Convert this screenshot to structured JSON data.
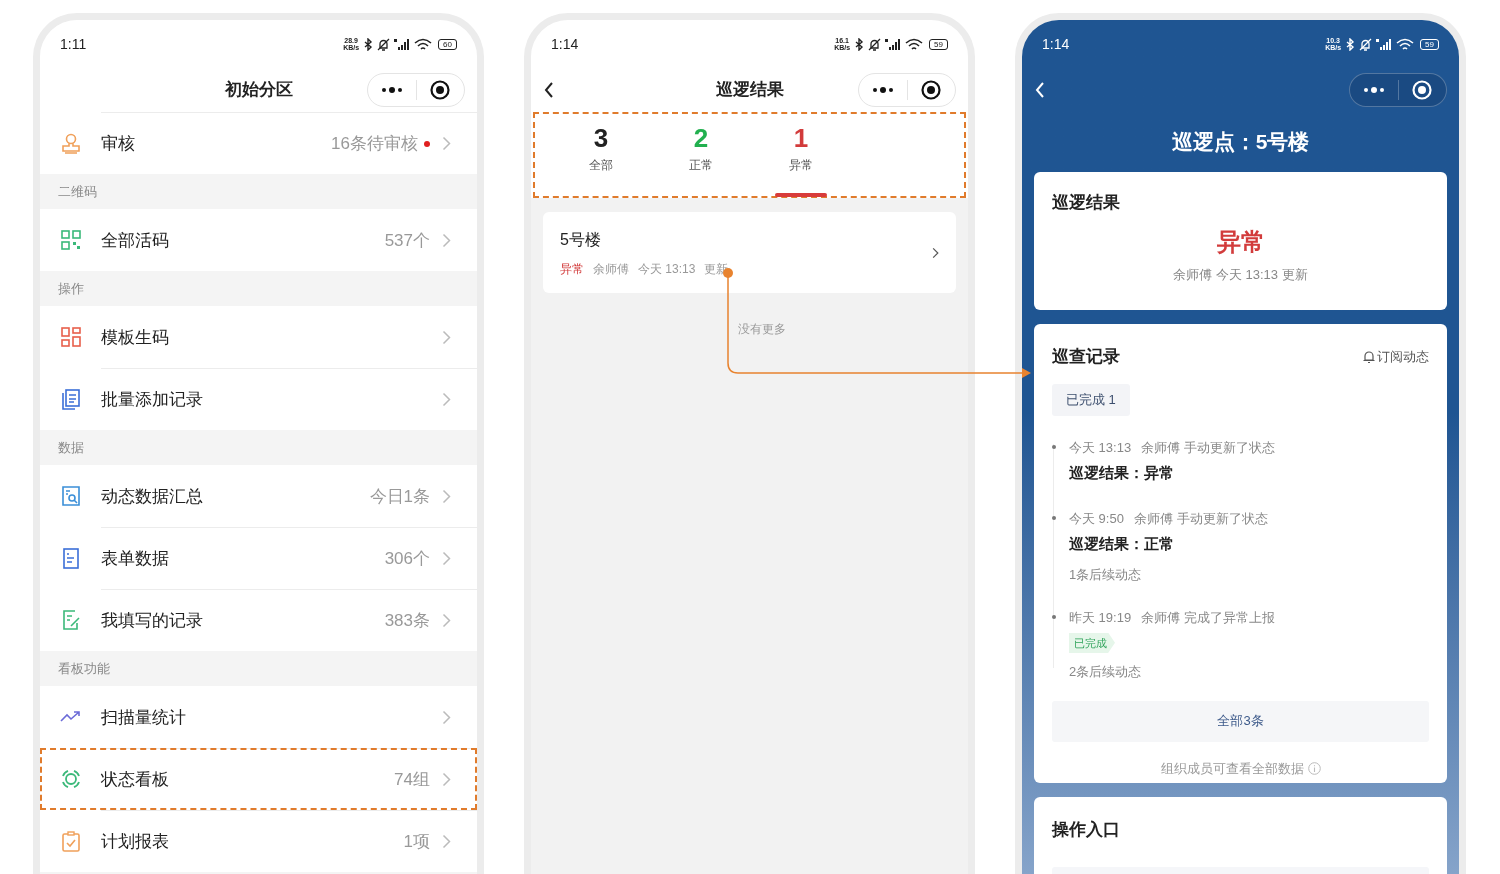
{
  "menu_screen": {
    "status_bar": {
      "time": "1:11",
      "speed": "28.9",
      "speed_unit": "KB/s",
      "battery": "60"
    },
    "title": "初始分区",
    "rows": [
      {
        "kind": "item",
        "label": "审核",
        "value": "16条待审核",
        "dot": true,
        "highlighted": false
      },
      {
        "kind": "section",
        "label": "二维码"
      },
      {
        "kind": "item",
        "label": "全部活码",
        "value": "537个",
        "dot": false,
        "highlighted": false
      },
      {
        "kind": "section",
        "label": "操作"
      },
      {
        "kind": "item",
        "label": "模板生码",
        "dot": false,
        "highlighted": false
      },
      {
        "kind": "item",
        "label": "批量添加记录",
        "dot": false,
        "highlighted": false
      },
      {
        "kind": "section",
        "label": "数据"
      },
      {
        "kind": "item",
        "label": "动态数据汇总",
        "value": "今日1条",
        "dot": false,
        "highlighted": false
      },
      {
        "kind": "item",
        "label": "表单数据",
        "value": "306个",
        "dot": false,
        "highlighted": false
      },
      {
        "kind": "item",
        "label": "我填写的记录",
        "value": "383条",
        "dot": false,
        "highlighted": false
      },
      {
        "kind": "section",
        "label": "看板功能"
      },
      {
        "kind": "item",
        "label": "扫描量统计",
        "dot": false,
        "highlighted": false
      },
      {
        "kind": "item",
        "label": "状态看板",
        "value": "74组",
        "dot": false,
        "highlighted": true
      },
      {
        "kind": "item",
        "label": "计划报表",
        "value": "1项",
        "dot": false,
        "highlighted": false
      }
    ]
  },
  "results_screen": {
    "status_bar": {
      "time": "1:14",
      "speed": "16.1",
      "speed_unit": "KB/s",
      "battery": "59"
    },
    "title": "巡逻结果",
    "tabs_highlighted": true,
    "tabs": [
      {
        "count": "3",
        "label": "全部",
        "color": "#222222",
        "selected": false
      },
      {
        "count": "2",
        "label": "正常",
        "color": "#22b04f",
        "selected": false
      },
      {
        "count": "1",
        "label": "异常",
        "color": "#d23b3b",
        "selected": true
      }
    ],
    "cards": [
      {
        "title": "5号楼",
        "status": "异常",
        "person": "余师傅",
        "time": "今天 13:13",
        "action": "更新"
      }
    ],
    "footer": "没有更多"
  },
  "detail_screen": {
    "status_bar": {
      "time": "1:14",
      "speed": "10.3",
      "speed_unit": "KB/s",
      "battery": "59"
    },
    "title": "巡逻点：5号楼",
    "result_card": {
      "title": "巡逻结果",
      "status": "异常",
      "meta": "余师傅 今天 13:13 更新"
    },
    "records_card": {
      "title": "巡查记录",
      "subscribe": "订阅动态",
      "filter_chip": "已完成 1",
      "entries": [
        {
          "time": "今天 13:13",
          "text": "余师傅 手动更新了状态",
          "result": "巡逻结果：异常"
        },
        {
          "time": "今天 9:50",
          "text": "余师傅 手动更新了状态",
          "result": "巡逻结果：正常",
          "followups": "1条后续动态"
        },
        {
          "time": "昨天 19:19",
          "text": "余师傅 完成了异常上报",
          "tag": "已完成",
          "followups": "2条后续动态"
        }
      ],
      "all_button": "全部3条",
      "note": "组织成员可查看全部数据"
    },
    "actions_card": {
      "title": "操作入口"
    }
  }
}
